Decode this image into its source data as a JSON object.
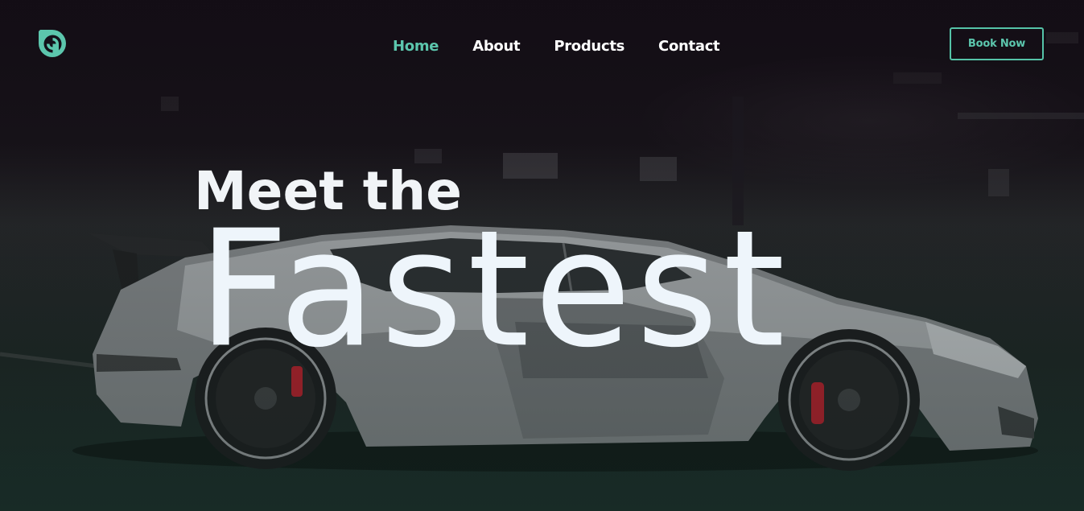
{
  "header": {
    "logo_icon": "circular-spiral-logo-icon",
    "nav": [
      {
        "label": "Home",
        "active": true
      },
      {
        "label": "About",
        "active": false
      },
      {
        "label": "Products",
        "active": false
      },
      {
        "label": "Contact",
        "active": false
      }
    ],
    "cta_label": "Book Now"
  },
  "hero": {
    "headline_small": "Meet the",
    "headline_large": "Fastest",
    "background": "dark photo of a silver supercar in profile"
  },
  "colors": {
    "accent": "#5cc6ad",
    "text": "#ffffff",
    "background_top": "#140e16",
    "background_bottom": "#1a2e29"
  }
}
